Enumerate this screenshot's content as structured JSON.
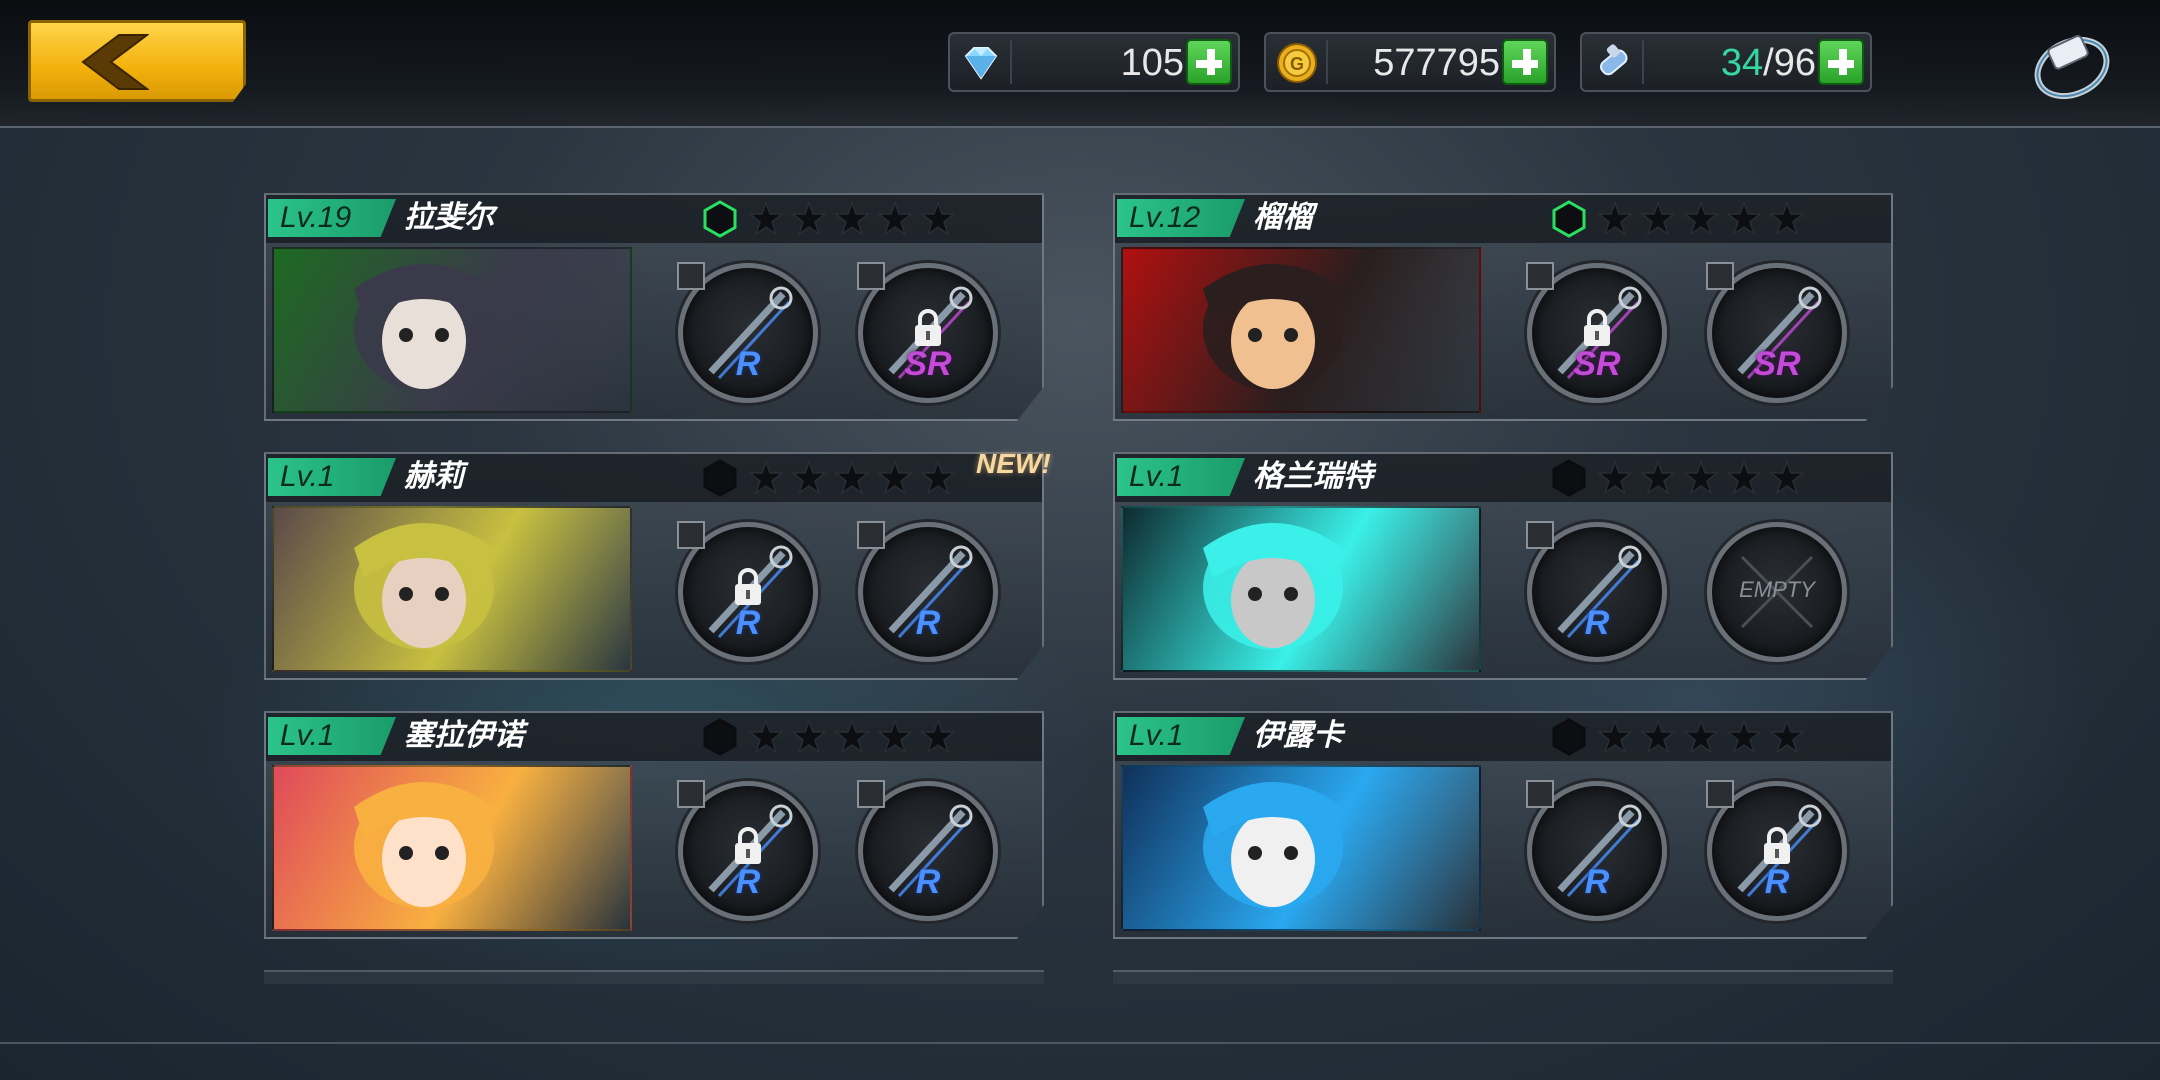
{
  "topbar": {
    "back_label": "",
    "diamonds": "105",
    "gold": "577795",
    "stamina_current": "34",
    "stamina_sep_max": "/96"
  },
  "characters": [
    {
      "level": "Lv.19",
      "name": "拉斐尔",
      "hex_color": "#2be060",
      "stars": 5,
      "new": "",
      "portrait_colors": [
        "#1e6a22",
        "#3a3a4a",
        "#e8e0d8"
      ],
      "slots": [
        {
          "rarity": "R",
          "locked": false,
          "empty": false
        },
        {
          "rarity": "SR",
          "locked": true,
          "empty": false
        }
      ]
    },
    {
      "level": "Lv.12",
      "name": "榴榴",
      "hex_color": "#2be060",
      "stars": 5,
      "new": "",
      "portrait_colors": [
        "#b01010",
        "#2a1e1e",
        "#f0c090"
      ],
      "slots": [
        {
          "rarity": "SR",
          "locked": true,
          "empty": false
        },
        {
          "rarity": "SR",
          "locked": false,
          "empty": false
        }
      ]
    },
    {
      "level": "Lv.1",
      "name": "赫莉",
      "hex_color": "#0a0c10",
      "stars": 5,
      "new": "NEW!",
      "portrait_colors": [
        "#5a4a4a",
        "#c8c040",
        "#e8d0c0"
      ],
      "slots": [
        {
          "rarity": "R",
          "locked": true,
          "empty": false
        },
        {
          "rarity": "R",
          "locked": false,
          "empty": false
        }
      ]
    },
    {
      "level": "Lv.1",
      "name": "格兰瑞特",
      "hex_color": "#0a0c10",
      "stars": 5,
      "new": "",
      "portrait_colors": [
        "#0e2a30",
        "#3af0e8",
        "#c8c8c8"
      ],
      "slots": [
        {
          "rarity": "R",
          "locked": false,
          "empty": false
        },
        {
          "rarity": "",
          "locked": false,
          "empty": true,
          "empty_label": "EMPTY"
        }
      ]
    },
    {
      "level": "Lv.1",
      "name": "塞拉伊诺",
      "hex_color": "#0a0c10",
      "stars": 5,
      "new": "",
      "portrait_colors": [
        "#e04a5a",
        "#f8b040",
        "#ffe0c8"
      ],
      "slots": [
        {
          "rarity": "R",
          "locked": true,
          "empty": false
        },
        {
          "rarity": "R",
          "locked": false,
          "empty": false
        }
      ]
    },
    {
      "level": "Lv.1",
      "name": "伊露卡",
      "hex_color": "#0a0c10",
      "stars": 5,
      "new": "",
      "portrait_colors": [
        "#10305a",
        "#2aa8f0",
        "#f0f0f0"
      ],
      "slots": [
        {
          "rarity": "R",
          "locked": false,
          "empty": false
        },
        {
          "rarity": "R",
          "locked": true,
          "empty": false
        }
      ]
    }
  ],
  "colors": {
    "accent_green": "#2bc48a",
    "gold_button": "#f2b10c",
    "rarity_r": "#4a90ff",
    "rarity_sr": "#c44ad8"
  },
  "icons": {
    "diamond": "diamond-icon",
    "gold": "gold-coin-icon",
    "stamina": "stamina-vial-icon",
    "settings": "bracelet-settings-icon",
    "back": "chevron-left-icon"
  }
}
